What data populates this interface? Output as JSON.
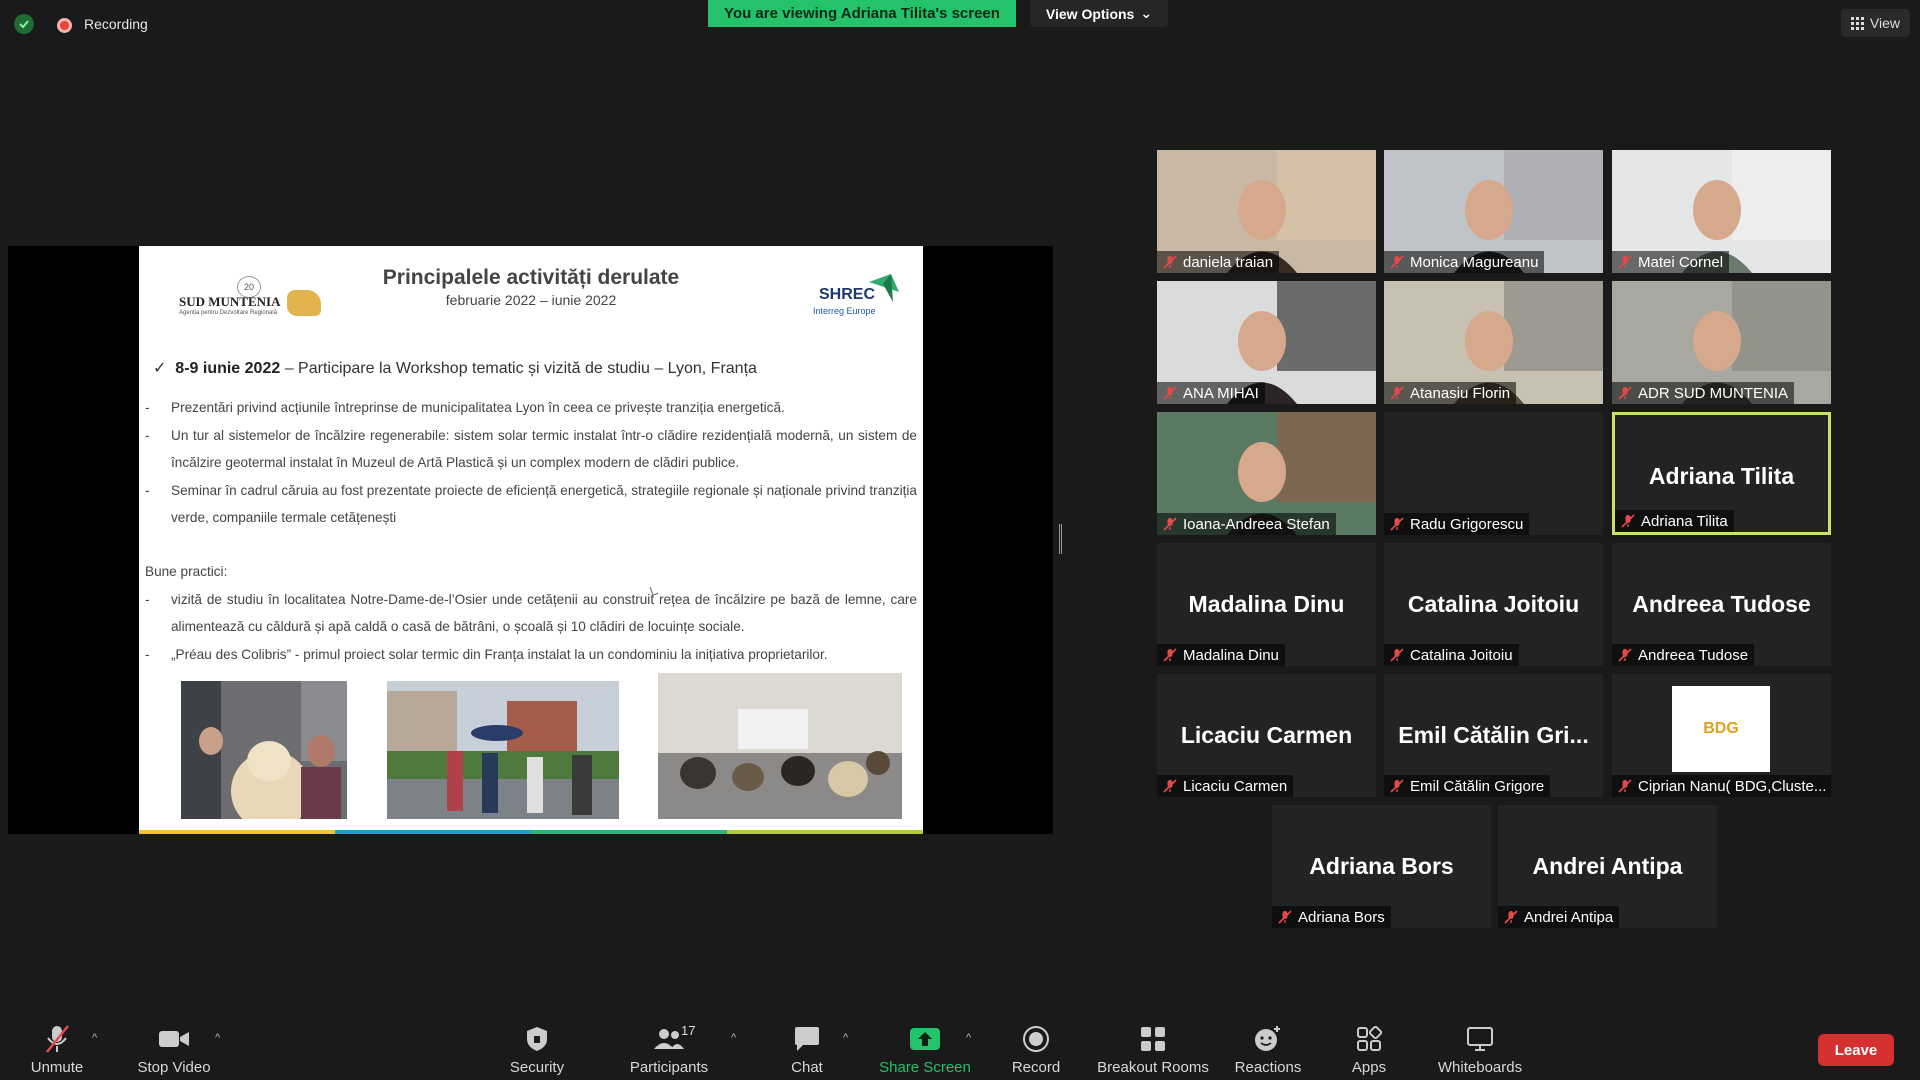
{
  "top": {
    "recording_label": "Recording",
    "viewing_banner": "You are viewing Adriana Tilita's screen",
    "view_options_label": "View Options",
    "view_label": "View"
  },
  "slide": {
    "title": "Principalele activități derulate",
    "subtitle": "februarie 2022 – iunie 2022",
    "left_logo_brand": "SUD MUNTENIA",
    "left_logo_sub": "Agenția pentru Dezvoltare Regională",
    "left_logo_badge": "20",
    "right_logo_name": "SHREC",
    "right_logo_sub": "Interreg Europe",
    "headline_bold": "8-9 iunie 2022",
    "headline_rest": " – Participare la Workshop tematic și vizită de studiu – Lyon, Franța",
    "bullets1": [
      "Prezentări privind acțiunile întreprinse de municipalitatea Lyon în ceea ce privește tranziția energetică.",
      "Un tur al sistemelor de încălzire regenerabile: sistem solar termic instalat într-o clădire rezidențială modernă, un sistem de încălzire geotermal instalat în Muzeul de Artă Plastică și un complex modern de clădiri publice.",
      "Seminar în cadrul căruia au fost prezentate proiecte de eficiență energetică, strategiile regionale și naționale privind tranziția verde, companiile termale cetățenești"
    ],
    "good_practices_label": "Bune practici:",
    "bullets2": [
      "vizită de studiu în localitatea Notre-Dame-de-l’Osier unde cetățenii au construit rețea de încălzire pe bază de lemne, care alimentează cu căldură și apă caldă o casă de bătrâni, o școală și 10 clădiri de locuințe sociale.",
      "„Préau des Colibris” -  primul proiect solar termic din Franța instalat la un condominiu la inițiativa  proprietarilor."
    ]
  },
  "participants": [
    {
      "name": "daniela traian",
      "video": true
    },
    {
      "name": "Monica Magureanu",
      "video": true
    },
    {
      "name": "Matei Cornel",
      "video": true
    },
    {
      "name": "ANA MIHAI",
      "video": true
    },
    {
      "name": "Atanasiu Florin",
      "video": true
    },
    {
      "name": "ADR SUD MUNTENIA",
      "video": true
    },
    {
      "name": "Ioana-Andreea Stefan",
      "video": true
    },
    {
      "name": "Radu Grigorescu",
      "video": false
    },
    {
      "name": "Adriana Tilita",
      "big": "Adriana Tilita",
      "active": true
    },
    {
      "name": "Madalina Dinu",
      "big": "Madalina Dinu"
    },
    {
      "name": "Catalina Joitoiu",
      "big": "Catalina Joitoiu"
    },
    {
      "name": "Andreea Tudose",
      "big": "Andreea Tudose"
    },
    {
      "name": "Licaciu Carmen",
      "big": "Licaciu Carmen"
    },
    {
      "name": "Emil Cătălin Grigore",
      "big": "Emil Cătălin Gri..."
    },
    {
      "name": "Ciprian Nanu( BDG,Cluste...",
      "logo": "BDG"
    },
    {
      "name": "Adriana Bors",
      "big": "Adriana Bors"
    },
    {
      "name": "Andrei Antipa",
      "big": "Andrei Antipa"
    }
  ],
  "toolbar": {
    "unmute": "Unmute",
    "stop_video": "Stop Video",
    "security": "Security",
    "participants": "Participants",
    "participants_count": "17",
    "chat": "Chat",
    "share_screen": "Share Screen",
    "record": "Record",
    "breakout_rooms": "Breakout Rooms",
    "reactions": "Reactions",
    "apps": "Apps",
    "whiteboards": "Whiteboards",
    "leave": "Leave"
  },
  "colors": {
    "banner_green": "#23c26b",
    "active_speaker": "#c7e36b",
    "leave_red": "#d62f2f"
  }
}
